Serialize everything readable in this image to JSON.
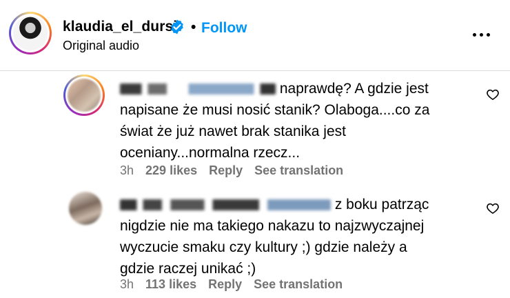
{
  "header": {
    "username": "klaudia_el_dursi",
    "separator": "•",
    "follow_label": "Follow",
    "subtitle": "Original audio"
  },
  "comments": [
    {
      "text": "naprawdę? A gdzie jest napisane że musi nosić stanik? Olaboga....co za świat że już nawet brak stanika jest oceniany...normalna rzecz...",
      "time": "3h",
      "likes": "229 likes",
      "reply": "Reply",
      "see_translation": "See translation"
    },
    {
      "text": "z boku patrząc nigdzie nie ma takiego nakazu to najzwyczajnej wyczucie smaku czy kultury ;) gdzie należy a gdzie raczej unikać ;)",
      "time": "3h",
      "likes": "113 likes",
      "reply": "Reply",
      "see_translation": "See translation"
    }
  ],
  "icons": {
    "verified": "verified-badge-icon",
    "more": "more-options-icon",
    "like": "heart-outline-icon"
  },
  "colors": {
    "link_blue": "#0095f6",
    "meta_gray": "#737373"
  }
}
